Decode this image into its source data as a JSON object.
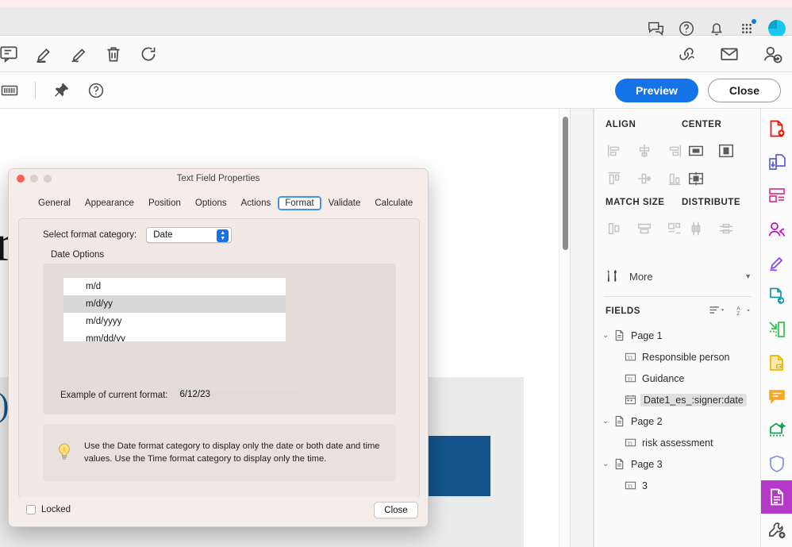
{
  "colors": {
    "accent_blue": "#1473e6",
    "doc_blue": "#14548c",
    "active_rail": "#b539c8",
    "tab_focus_ring": "#4a90e8",
    "selection_gray": "#d8d8d8"
  },
  "menubar": {
    "icons": [
      {
        "name": "feedback-icon",
        "glyph": "feedback"
      },
      {
        "name": "help-icon",
        "glyph": "question-circle"
      },
      {
        "name": "notifications-bell-icon",
        "glyph": "bell"
      },
      {
        "name": "app-grid-icon",
        "glyph": "grid-dots"
      },
      {
        "name": "user-avatar",
        "glyph": "avatar"
      }
    ]
  },
  "toolbar": {
    "left_icons": [
      {
        "name": "comment-icon",
        "glyph": "comment"
      },
      {
        "name": "highlighter-icon",
        "glyph": "highlighter"
      },
      {
        "name": "signature-pen-icon",
        "glyph": "signature-pen"
      },
      {
        "name": "delete-trash-icon",
        "glyph": "trash"
      },
      {
        "name": "rotate-icon",
        "glyph": "rotate"
      }
    ],
    "right_icons": [
      {
        "name": "share-link-icon",
        "glyph": "link-cloud"
      },
      {
        "name": "send-email-icon",
        "glyph": "envelope"
      },
      {
        "name": "add-recipient-icon",
        "glyph": "person-plus"
      }
    ]
  },
  "subtoolbar": {
    "left_icons": [
      {
        "name": "barcode-field-icon",
        "glyph": "barcode"
      },
      {
        "name": "pin-icon",
        "glyph": "pin"
      },
      {
        "name": "help-circle-icon",
        "glyph": "question-circle"
      }
    ],
    "preview_label": "Preview",
    "close_label": "Close"
  },
  "document": {
    "heading_fragment": "orm",
    "blue_text_fragment": "ds)",
    "scrollbar_name": "document-scrollbar"
  },
  "right_panel": {
    "align_header": "ALIGN",
    "center_header": "CENTER",
    "match_size_header": "MATCH SIZE",
    "distribute_header": "DISTRIBUTE",
    "align_tools": [
      {
        "name": "align-left-icon",
        "enabled": false
      },
      {
        "name": "align-horizontal-center-icon",
        "enabled": false
      },
      {
        "name": "align-right-icon",
        "enabled": false
      },
      {
        "name": "align-top-icon",
        "enabled": false
      },
      {
        "name": "align-vertical-center-icon",
        "enabled": false
      },
      {
        "name": "align-bottom-icon",
        "enabled": false
      }
    ],
    "center_tools": [
      {
        "name": "center-horizontally-icon",
        "enabled": true
      },
      {
        "name": "center-vertically-icon",
        "enabled": true
      },
      {
        "name": "center-both-icon",
        "enabled": true
      }
    ],
    "match_size_tools": [
      {
        "name": "match-width-icon",
        "enabled": false
      },
      {
        "name": "match-height-icon",
        "enabled": false
      },
      {
        "name": "match-both-icon",
        "enabled": false
      }
    ],
    "distribute_tools": [
      {
        "name": "distribute-vertically-icon",
        "enabled": false
      },
      {
        "name": "distribute-horizontally-icon",
        "enabled": false
      }
    ],
    "more_label": "More",
    "fields_header": "FIELDS",
    "tree": [
      {
        "type": "page",
        "label": "Page 1",
        "expanded": true,
        "icon": "page-icon"
      },
      {
        "type": "field",
        "label": "Responsible person",
        "icon": "text-field-icon",
        "selected": false
      },
      {
        "type": "field",
        "label": "Guidance",
        "icon": "text-field-icon",
        "selected": false
      },
      {
        "type": "field",
        "label": "Date1_es_:signer:date",
        "icon": "date-field-icon",
        "selected": true
      },
      {
        "type": "page",
        "label": "Page 2",
        "expanded": true,
        "icon": "page-icon"
      },
      {
        "type": "field",
        "label": "risk assessment",
        "icon": "text-field-icon",
        "selected": false
      },
      {
        "type": "page",
        "label": "Page 3",
        "expanded": true,
        "icon": "page-icon"
      },
      {
        "type": "field",
        "label": "3",
        "icon": "text-field-icon",
        "selected": false
      }
    ]
  },
  "rail": [
    {
      "name": "create-pdf-icon",
      "color": "#eb1000"
    },
    {
      "name": "export-pdf-icon",
      "color": "#5c5ce0"
    },
    {
      "name": "organize-pages-icon",
      "color": "#e8308a"
    },
    {
      "name": "redact-icon",
      "color": "#c209c1"
    },
    {
      "name": "fill-and-sign-icon",
      "color": "#8a3ffc"
    },
    {
      "name": "send-for-signature-icon",
      "color": "#0d9ba8"
    },
    {
      "name": "compress-pdf-icon",
      "color": "#2ec14e"
    },
    {
      "name": "add-comment-icon",
      "color": "#e8b904"
    },
    {
      "name": "comment-icon",
      "color": "#f5a623"
    },
    {
      "name": "scan-and-ocr-icon",
      "color": "#12a150"
    },
    {
      "name": "protect-icon",
      "color": "#8a8ae0"
    },
    {
      "name": "prepare-form-icon",
      "color": "#ffffff",
      "active": true
    },
    {
      "name": "more-tools-icon",
      "color": "#4a4a4a"
    }
  ],
  "dialog": {
    "title": "Text Field Properties",
    "tabs": [
      {
        "label": "General",
        "active": false
      },
      {
        "label": "Appearance",
        "active": false
      },
      {
        "label": "Position",
        "active": false
      },
      {
        "label": "Options",
        "active": false
      },
      {
        "label": "Actions",
        "active": false
      },
      {
        "label": "Format",
        "active": true
      },
      {
        "label": "Validate",
        "active": false
      },
      {
        "label": "Calculate",
        "active": false
      }
    ],
    "format_category_label": "Select format category:",
    "format_category_value": "Date",
    "date_options_label": "Date Options",
    "date_formats": [
      {
        "label": "m/d",
        "selected": false
      },
      {
        "label": "m/d/yy",
        "selected": true
      },
      {
        "label": "m/d/yyyy",
        "selected": false
      },
      {
        "label": "mm/dd/yy",
        "selected": false
      }
    ],
    "example_label": "Example of current format:",
    "example_value": "6/12/23",
    "tip_text": "Use the Date format category to display only the date or both date and time values. Use the Time format category to display only the time.",
    "locked_label": "Locked",
    "locked_checked": false,
    "close_label": "Close"
  }
}
